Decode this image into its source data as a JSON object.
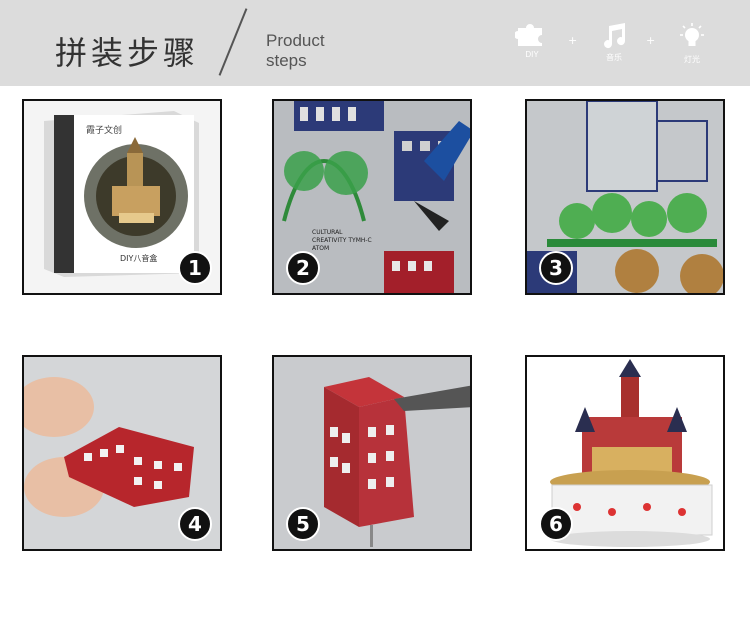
{
  "header": {
    "title_cn": "拼装步骤",
    "title_en_line1": "Product",
    "title_en_line2": "steps",
    "icons": [
      {
        "name": "puzzle-icon",
        "label": "DIY"
      },
      {
        "name": "music-note-icon",
        "label": "音乐"
      },
      {
        "name": "light-bulb-icon",
        "label": "灯光"
      }
    ],
    "separator": "+"
  },
  "steps": [
    {
      "number": "1",
      "box_text": "DIY八音盒",
      "brand_text": "霞子文创"
    },
    {
      "number": "2",
      "sheet_text_1": "CULTURAL",
      "sheet_text_2": "CREATIVITY",
      "sheet_text_3": "TYMH-C",
      "sheet_text_4": "ATOM"
    },
    {
      "number": "3"
    },
    {
      "number": "4"
    },
    {
      "number": "5"
    },
    {
      "number": "6"
    }
  ]
}
